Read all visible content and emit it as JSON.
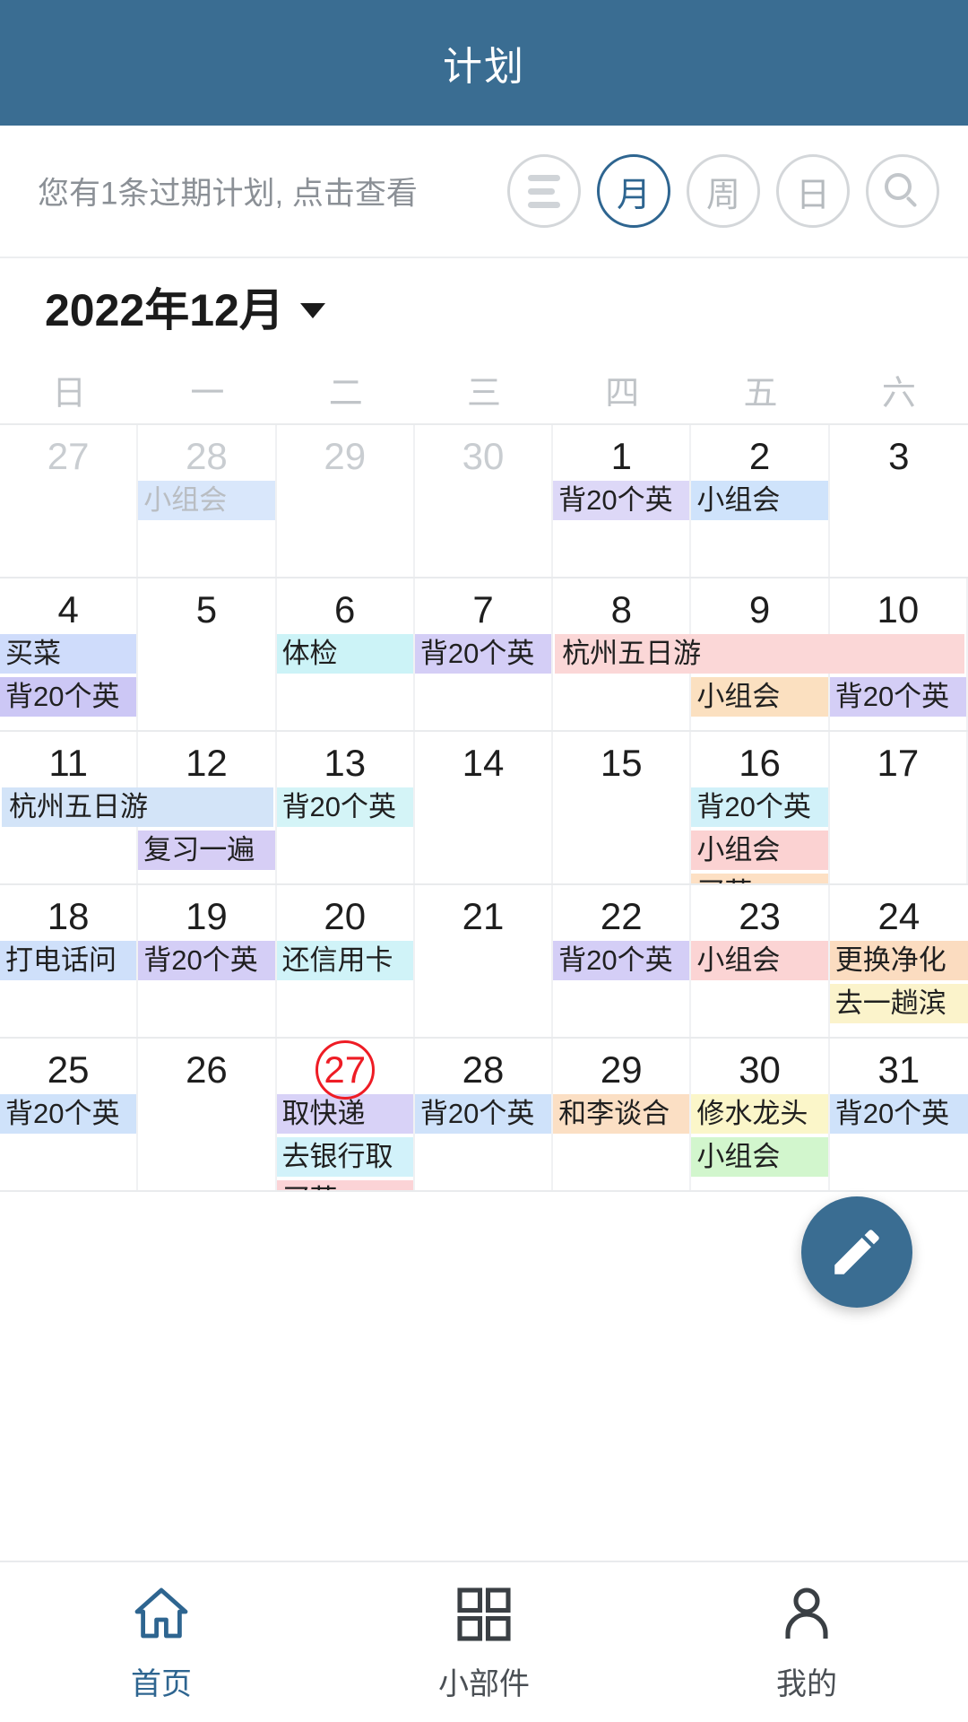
{
  "titlebar": {
    "title": "计划"
  },
  "toolbar": {
    "overdue_note": "您有1条过期计划, 点击查看",
    "buttons": [
      {
        "name": "list-view",
        "label": ""
      },
      {
        "name": "month-view",
        "label": "月",
        "active": true
      },
      {
        "name": "week-view",
        "label": "周",
        "active": false
      },
      {
        "name": "day-view",
        "label": "日",
        "active": false
      },
      {
        "name": "search",
        "label": ""
      }
    ]
  },
  "month_header": {
    "label": "2022年12月"
  },
  "weekdays": [
    "日",
    "一",
    "二",
    "三",
    "四",
    "五",
    "六"
  ],
  "calendar": {
    "today": 27,
    "weeks": [
      {
        "days": [
          {
            "num": "27",
            "other": true,
            "events": []
          },
          {
            "num": "28",
            "other": true,
            "events": [
              {
                "text": "小组会",
                "bg": "#d9e7fb",
                "dim": true
              }
            ]
          },
          {
            "num": "29",
            "other": true,
            "events": []
          },
          {
            "num": "30",
            "other": true,
            "events": []
          },
          {
            "num": "1",
            "other": false,
            "events": [
              {
                "text": "背20个英",
                "bg": "#ddd8f7",
                "dim": false
              }
            ]
          },
          {
            "num": "2",
            "other": false,
            "events": [
              {
                "text": "小组会",
                "bg": "#cfe3fb",
                "dim": false
              }
            ]
          },
          {
            "num": "3",
            "other": false,
            "events": []
          }
        ],
        "spans": []
      },
      {
        "days": [
          {
            "num": "4",
            "other": false,
            "events": [
              {
                "text": "买菜",
                "bg": "#cfdcfb",
                "dim": false
              },
              {
                "text": "背20个英",
                "bg": "#ccc7f5",
                "dim": false
              }
            ]
          },
          {
            "num": "5",
            "other": false,
            "events": []
          },
          {
            "num": "6",
            "other": false,
            "events": [
              {
                "text": "体检",
                "bg": "#ccf3f7",
                "dim": false
              }
            ]
          },
          {
            "num": "7",
            "other": false,
            "events": [
              {
                "text": "背20个英",
                "bg": "#d4cef6",
                "dim": false
              }
            ]
          },
          {
            "num": "8",
            "other": false,
            "events": []
          },
          {
            "num": "9",
            "other": false,
            "events": [
              {
                "text": "",
                "bg": "transparent",
                "dim": false
              },
              {
                "text": "小组会",
                "bg": "#fbe0c0",
                "dim": false
              }
            ]
          },
          {
            "num": "10",
            "other": false,
            "events": [
              {
                "text": "",
                "bg": "transparent",
                "dim": false
              },
              {
                "text": "背20个英",
                "bg": "#d4cef6",
                "dim": false
              }
            ]
          }
        ],
        "spans": [
          {
            "text": "杭州五日游",
            "bg": "#fbd7d7",
            "start": 4,
            "end": 6,
            "row": 0
          }
        ]
      },
      {
        "days": [
          {
            "num": "11",
            "other": false,
            "events": []
          },
          {
            "num": "12",
            "other": false,
            "events": [
              {
                "text": "",
                "bg": "transparent",
                "dim": false
              },
              {
                "text": "复习一遍",
                "bg": "#d6cef5",
                "dim": false
              }
            ]
          },
          {
            "num": "13",
            "other": false,
            "events": [
              {
                "text": "背20个英",
                "bg": "#d4f4f7",
                "dim": false
              }
            ]
          },
          {
            "num": "14",
            "other": false,
            "events": []
          },
          {
            "num": "15",
            "other": false,
            "events": []
          },
          {
            "num": "16",
            "other": false,
            "events": [
              {
                "text": "背20个英",
                "bg": "#d1f1f9",
                "dim": false
              },
              {
                "text": "小组会",
                "bg": "#fbd2d2",
                "dim": false
              },
              {
                "text": "买菜",
                "bg": "#fde0c4",
                "dim": false
              }
            ]
          },
          {
            "num": "17",
            "other": false,
            "events": []
          }
        ],
        "spans": [
          {
            "text": "杭州五日游",
            "bg": "#d3e4f8",
            "start": 0,
            "end": 1,
            "row": 0
          }
        ]
      },
      {
        "days": [
          {
            "num": "18",
            "other": false,
            "events": [
              {
                "text": "打电话问",
                "bg": "#cfe0fa",
                "dim": false
              }
            ]
          },
          {
            "num": "19",
            "other": false,
            "events": [
              {
                "text": "背20个英",
                "bg": "#d4cef6",
                "dim": false
              }
            ]
          },
          {
            "num": "20",
            "other": false,
            "events": [
              {
                "text": "还信用卡",
                "bg": "#d0f3f8",
                "dim": false
              }
            ]
          },
          {
            "num": "21",
            "other": false,
            "events": []
          },
          {
            "num": "22",
            "other": false,
            "events": [
              {
                "text": "背20个英",
                "bg": "#d4cef6",
                "dim": false
              }
            ]
          },
          {
            "num": "23",
            "other": false,
            "events": [
              {
                "text": "小组会",
                "bg": "#fbd4d4",
                "dim": false
              }
            ]
          },
          {
            "num": "24",
            "other": false,
            "events": [
              {
                "text": "更换净化",
                "bg": "#fbdcc0",
                "dim": false
              },
              {
                "text": "去一趟滨",
                "bg": "#fbf3cb",
                "dim": false
              }
            ]
          }
        ],
        "spans": []
      },
      {
        "days": [
          {
            "num": "25",
            "other": false,
            "events": [
              {
                "text": "背20个英",
                "bg": "#cfe2fa",
                "dim": false
              }
            ]
          },
          {
            "num": "26",
            "other": false,
            "events": []
          },
          {
            "num": "27",
            "other": false,
            "today": true,
            "events": [
              {
                "text": "取快递",
                "bg": "#d8d2f7",
                "dim": false
              },
              {
                "text": "去银行取",
                "bg": "#d2f2fa",
                "dim": false
              },
              {
                "text": "买菜",
                "bg": "#fbd3d6",
                "dim": false
              }
            ]
          },
          {
            "num": "28",
            "other": false,
            "events": [
              {
                "text": "背20个英",
                "bg": "#cfe2fa",
                "dim": false
              }
            ]
          },
          {
            "num": "29",
            "other": false,
            "events": [
              {
                "text": "和李谈合",
                "bg": "#fbdfc4",
                "dim": false
              }
            ]
          },
          {
            "num": "30",
            "other": false,
            "events": [
              {
                "text": "修水龙头",
                "bg": "#fbf6c9",
                "dim": false
              },
              {
                "text": "小组会",
                "bg": "#d2f6cd",
                "dim": false
              }
            ]
          },
          {
            "num": "31",
            "other": false,
            "events": [
              {
                "text": "背20个英",
                "bg": "#cfe2fa",
                "dim": false
              }
            ]
          }
        ],
        "spans": []
      }
    ]
  },
  "fab": {
    "name": "compose-button"
  },
  "bottomnav": {
    "items": [
      {
        "label": "首页",
        "icon": "home-icon",
        "active": true
      },
      {
        "label": "小部件",
        "icon": "widgets-icon",
        "active": false
      },
      {
        "label": "我的",
        "icon": "person-icon",
        "active": false
      }
    ]
  },
  "colors": {
    "brand": "#3a6d92",
    "accent": "#2e6590",
    "today_ring": "#ee1c25"
  }
}
